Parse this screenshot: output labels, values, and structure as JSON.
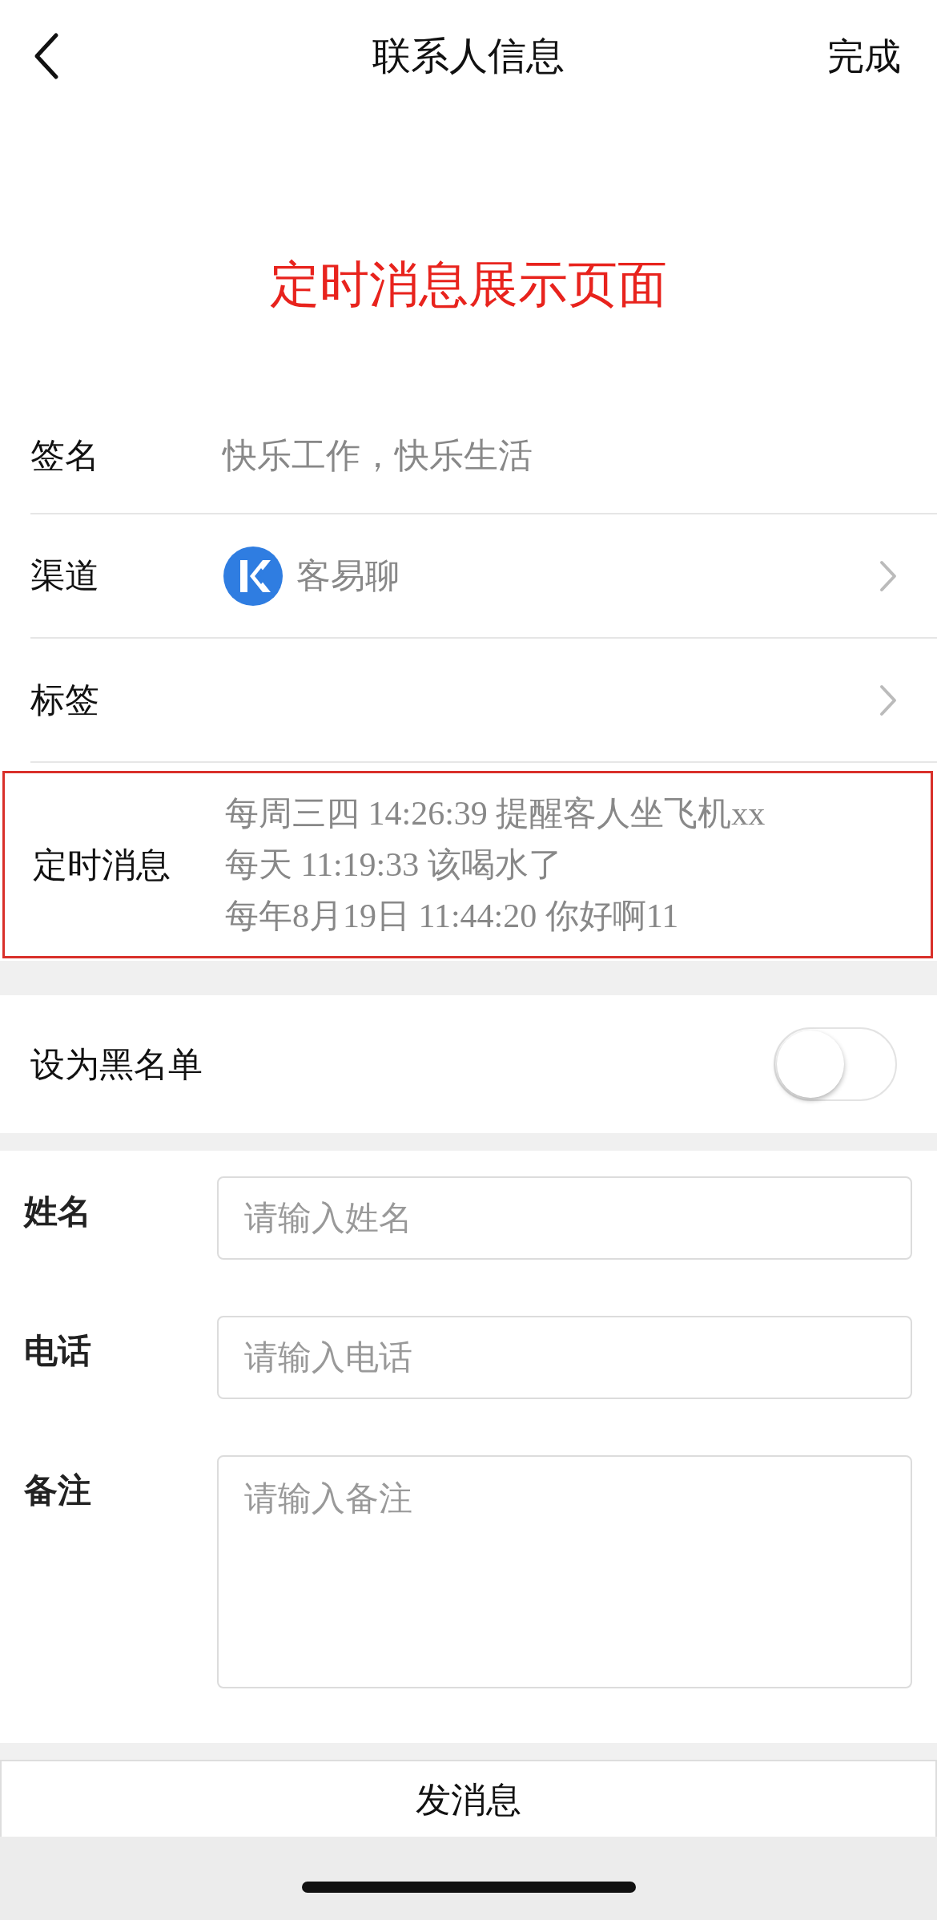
{
  "header": {
    "title": "联系人信息",
    "action": "完成"
  },
  "banner": "定时消息展示页面",
  "info_rows": [
    {
      "kind": "text",
      "label": "签名",
      "value": "快乐工作，快乐生活"
    },
    {
      "kind": "channel",
      "label": "渠道",
      "value": "客易聊"
    },
    {
      "kind": "link",
      "label": "标签"
    }
  ],
  "scheduled": {
    "label": "定时消息",
    "highlighted": true,
    "messages": [
      "每周三四 14:26:39 提醒客人坐飞机xx",
      "每天 11:19:33 该喝水了",
      "每年8月19日 11:44:20 你好啊11"
    ]
  },
  "blacklist": {
    "label": "设为黑名单",
    "on": false
  },
  "form": [
    {
      "kind": "input",
      "label": "姓名",
      "placeholder": "请输入姓名"
    },
    {
      "kind": "input",
      "label": "电话",
      "placeholder": "请输入电话"
    },
    {
      "kind": "textarea",
      "label": "备注",
      "placeholder": "请输入备注"
    }
  ],
  "send_button": "发消息"
}
